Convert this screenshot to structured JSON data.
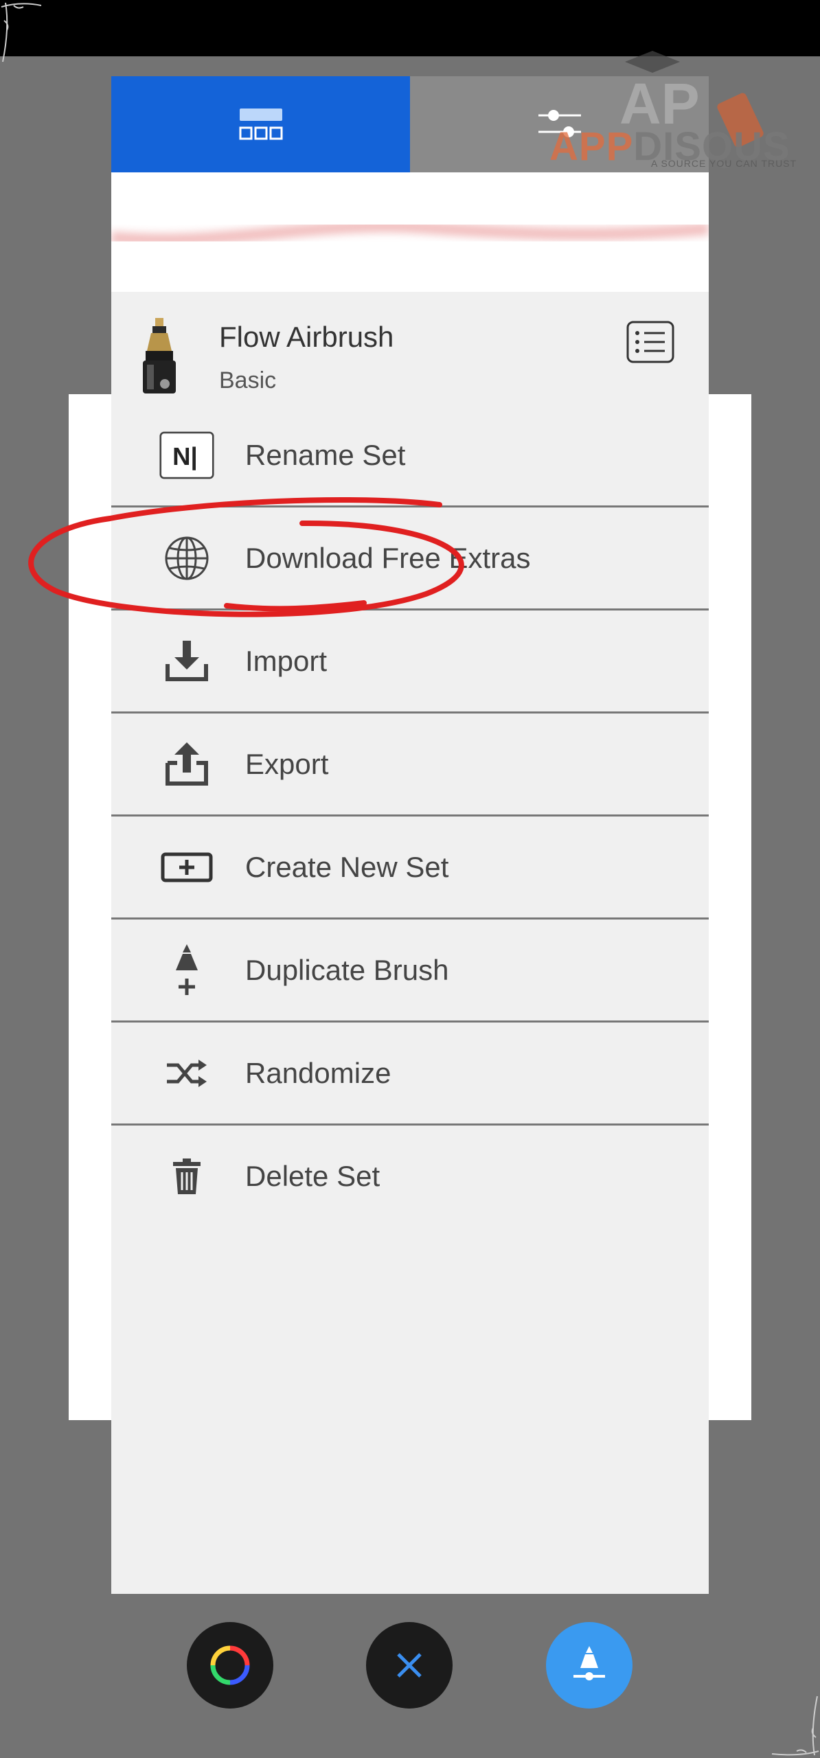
{
  "brush": {
    "name": "Flow Airbrush",
    "set": "Basic"
  },
  "menu": {
    "items": [
      {
        "label": "Rename Set",
        "icon": "rename-icon"
      },
      {
        "label": "Download Free Extras",
        "icon": "globe-icon"
      },
      {
        "label": "Import",
        "icon": "import-icon"
      },
      {
        "label": "Export",
        "icon": "export-icon"
      },
      {
        "label": "Create New Set",
        "icon": "add-set-icon"
      },
      {
        "label": "Duplicate Brush",
        "icon": "duplicate-brush-icon"
      },
      {
        "label": "Randomize",
        "icon": "shuffle-icon"
      },
      {
        "label": "Delete Set",
        "icon": "trash-icon"
      }
    ]
  },
  "rename_icon_glyph": "N|",
  "watermark": {
    "logo_letters": "AP",
    "brand_part1": "APP",
    "brand_part2": "DISQUS",
    "tagline": "A SOURCE YOU CAN TRUST"
  },
  "colors": {
    "accent": "#1463d8",
    "brush_button": "#3a9af0",
    "highlight": "#e02020"
  }
}
